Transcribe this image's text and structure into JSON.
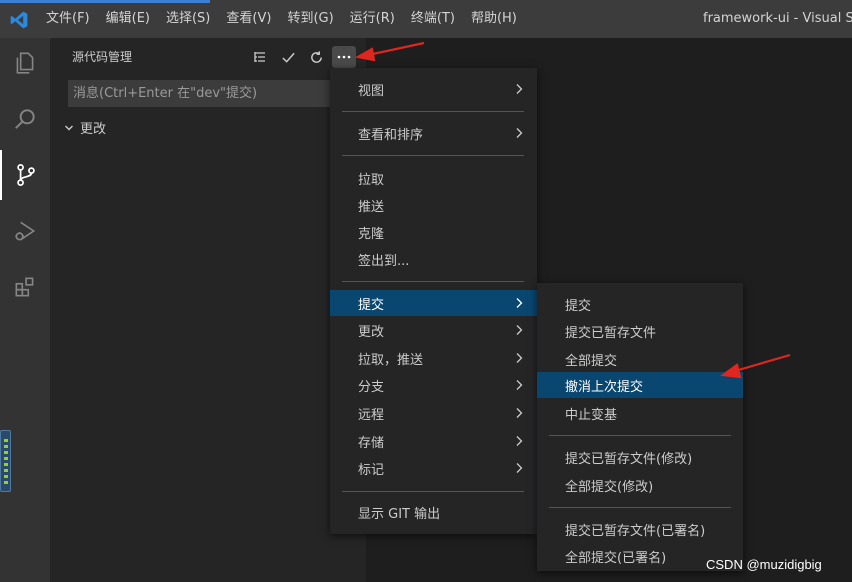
{
  "titlebar": {
    "menu": [
      "文件(F)",
      "编辑(E)",
      "选择(S)",
      "查看(V)",
      "转到(G)",
      "运行(R)",
      "终端(T)",
      "帮助(H)"
    ],
    "window_title": "framework-ui - Visual Stuc"
  },
  "activitybar": {
    "items": [
      "explorer-icon",
      "search-icon",
      "source-control-icon",
      "run-debug-icon",
      "extensions-icon"
    ],
    "active": "source-control-icon"
  },
  "sidebar": {
    "title": "源代码管理",
    "actions": [
      "view-as-tree-icon",
      "commit-check-icon",
      "refresh-icon",
      "more-actions-icon"
    ],
    "commit_placeholder": "消息(Ctrl+Enter 在\"dev\"提交)",
    "changes_label": "更改"
  },
  "main_menu": {
    "groups": [
      [
        {
          "label": "视图",
          "submenu": true
        }
      ],
      [
        {
          "label": "查看和排序",
          "submenu": true
        }
      ],
      [
        {
          "label": "拉取"
        },
        {
          "label": "推送"
        },
        {
          "label": "克隆"
        },
        {
          "label": "签出到..."
        }
      ],
      [
        {
          "label": "提交",
          "submenu": true,
          "highlighted": true
        },
        {
          "label": "更改",
          "submenu": true
        },
        {
          "label": "拉取，推送",
          "submenu": true
        },
        {
          "label": "分支",
          "submenu": true
        },
        {
          "label": "远程",
          "submenu": true
        },
        {
          "label": "存储",
          "submenu": true
        },
        {
          "label": "标记",
          "submenu": true
        }
      ],
      [
        {
          "label": "显示 GIT 输出"
        }
      ]
    ]
  },
  "sub_menu": {
    "groups": [
      [
        {
          "label": "提交"
        },
        {
          "label": "提交已暂存文件"
        },
        {
          "label": "全部提交"
        },
        {
          "label": "撤消上次提交",
          "highlighted": true
        },
        {
          "label": "中止变基"
        }
      ],
      [
        {
          "label": "提交已暂存文件(修改)"
        },
        {
          "label": "全部提交(修改)"
        }
      ],
      [
        {
          "label": "提交已暂存文件(已署名)"
        },
        {
          "label": "全部提交(已署名)"
        }
      ]
    ]
  },
  "watermark": "CSDN @muzidigbig",
  "colors": {
    "highlight": "#094771",
    "annotation": "#e0261f",
    "accent": "#3c7fd6"
  }
}
